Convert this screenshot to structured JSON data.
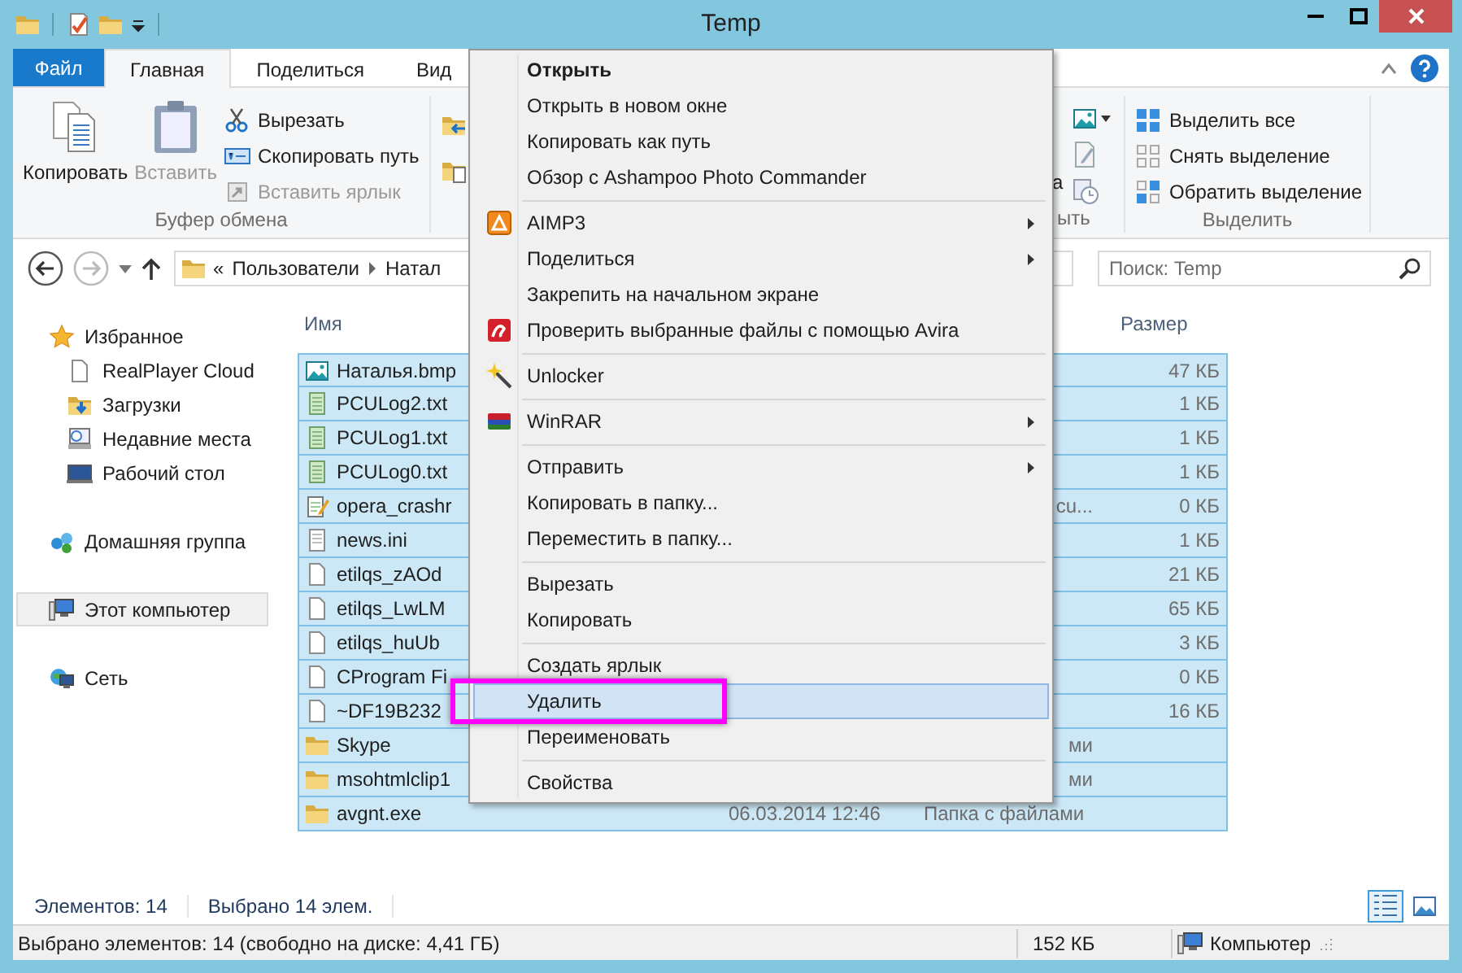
{
  "window": {
    "title": "Temp"
  },
  "ribbon": {
    "file_tab": "Файл",
    "tabs": [
      {
        "label": "Главная",
        "selected": true
      },
      {
        "label": "Поделиться",
        "selected": false
      },
      {
        "label": "Вид",
        "selected": false
      }
    ],
    "groups": [
      {
        "kind": "clipboard",
        "label": "Буфер обмена",
        "large": [
          {
            "label": "Копировать",
            "disabled": false
          },
          {
            "label": "Вставить",
            "disabled": true
          }
        ],
        "small": [
          {
            "label": "Вырезать",
            "disabled": false
          },
          {
            "label": "Скопировать путь",
            "disabled": false
          },
          {
            "label": "Вставить ярлык",
            "disabled": true
          }
        ]
      },
      {
        "kind": "organize"
      },
      {
        "kind": "open",
        "label": "ыть",
        "fragment": "а"
      },
      {
        "kind": "select",
        "label": "Выделить",
        "items": [
          "Выделить все",
          "Снять выделение",
          "Обратить выделение"
        ]
      }
    ]
  },
  "address": {
    "overflow": "«",
    "path": [
      "Пользователи",
      "Натал"
    ],
    "search_placeholder": "Поиск: Temp"
  },
  "nav": [
    {
      "label": "Избранное",
      "selected": false,
      "children": [
        {
          "label": "RealPlayer Cloud",
          "selected": false
        },
        {
          "label": "Загрузки",
          "selected": false
        },
        {
          "label": "Недавние места",
          "selected": false
        },
        {
          "label": "Рабочий стол",
          "selected": false
        }
      ]
    },
    {
      "label": "Домашняя группа",
      "selected": false
    },
    {
      "label": "Этот компьютер",
      "selected": true
    },
    {
      "label": "Сеть",
      "selected": false
    }
  ],
  "files": {
    "columns": [
      "Имя",
      "Размер"
    ],
    "rows": [
      {
        "kind": "image",
        "name": "Наталья.bmp",
        "size": "47 КБ",
        "selected": true
      },
      {
        "kind": "text",
        "name": "PCULog2.txt",
        "size": "1 КБ",
        "selected": true
      },
      {
        "kind": "text",
        "name": "PCULog1.txt",
        "size": "1 КБ",
        "selected": true
      },
      {
        "kind": "text",
        "name": "PCULog0.txt",
        "size": "1 КБ",
        "selected": true
      },
      {
        "kind": "script",
        "name": "opera_crashr",
        "type_tail": "cu...",
        "size": "0 КБ",
        "selected": true
      },
      {
        "kind": "ini",
        "name": "news.ini",
        "size": "1 КБ",
        "selected": true
      },
      {
        "kind": "file",
        "name": "etilqs_zAOd",
        "size": "21 КБ",
        "selected": true
      },
      {
        "kind": "file",
        "name": "etilqs_LwLM",
        "size": "65 КБ",
        "selected": true
      },
      {
        "kind": "file",
        "name": "etilqs_huUb",
        "size": "3 КБ",
        "selected": true
      },
      {
        "kind": "file",
        "name": "CProgram Fi",
        "size": "0 КБ",
        "selected": true
      },
      {
        "kind": "file",
        "name": "~DF19B232",
        "size": "16 КБ",
        "selected": true
      },
      {
        "kind": "folder",
        "name": "Skype",
        "type_tail": "ми",
        "selected": true
      },
      {
        "kind": "folder",
        "name": "msohtmlclip1",
        "type_tail": "ми",
        "selected": true
      },
      {
        "kind": "folder",
        "name": "avgnt.exe",
        "date": "06.03.2014 12:46",
        "type": "Папка с файлами",
        "selected": true
      }
    ]
  },
  "info": {
    "item_count": "Элементов: 14",
    "selection_count": "Выбрано 14 элем.",
    "views": [
      {
        "selected": true
      },
      {
        "selected": false
      }
    ]
  },
  "status_bar": {
    "summary": "Выбрано элементов: 14 (свободно на диске: 4,41 ГБ)",
    "size": "152 КБ",
    "location": "Компьютер"
  },
  "context_menu": {
    "items": [
      {
        "kind": "item",
        "label": "Открыть",
        "default": true,
        "submenu": false,
        "selected": false
      },
      {
        "kind": "item",
        "label": "Открыть в новом окне",
        "default": false,
        "submenu": false,
        "selected": false
      },
      {
        "kind": "item",
        "label": "Копировать как путь",
        "default": false,
        "submenu": false,
        "selected": false
      },
      {
        "kind": "item",
        "label": "Обзор с Ashampoo Photo Commander",
        "default": false,
        "submenu": false,
        "selected": false
      },
      {
        "kind": "separator"
      },
      {
        "kind": "item",
        "label": "AIMP3",
        "default": false,
        "submenu": true,
        "selected": false
      },
      {
        "kind": "item",
        "label": "Поделиться",
        "default": false,
        "submenu": true,
        "selected": false
      },
      {
        "kind": "item",
        "label": "Закрепить на начальном экране",
        "default": false,
        "submenu": false,
        "selected": false
      },
      {
        "kind": "item",
        "label": "Проверить выбранные файлы с помощью Avira",
        "default": false,
        "submenu": false,
        "selected": false
      },
      {
        "kind": "separator"
      },
      {
        "kind": "item",
        "label": "Unlocker",
        "default": false,
        "submenu": false,
        "selected": false
      },
      {
        "kind": "separator"
      },
      {
        "kind": "item",
        "label": "WinRAR",
        "default": false,
        "submenu": true,
        "selected": false
      },
      {
        "kind": "separator"
      },
      {
        "kind": "item",
        "label": "Отправить",
        "default": false,
        "submenu": true,
        "selected": false
      },
      {
        "kind": "item",
        "label": "Копировать в папку...",
        "default": false,
        "submenu": false,
        "selected": false
      },
      {
        "kind": "item",
        "label": "Переместить в папку...",
        "default": false,
        "submenu": false,
        "selected": false
      },
      {
        "kind": "separator"
      },
      {
        "kind": "item",
        "label": "Вырезать",
        "default": false,
        "submenu": false,
        "selected": false
      },
      {
        "kind": "item",
        "label": "Копировать",
        "default": false,
        "submenu": false,
        "selected": false
      },
      {
        "kind": "separator"
      },
      {
        "kind": "item",
        "label": "Создать ярлык",
        "default": false,
        "submenu": false,
        "selected": false
      },
      {
        "kind": "item",
        "label": "Удалить",
        "default": false,
        "submenu": false,
        "selected": true
      },
      {
        "kind": "item",
        "label": "Переименовать",
        "default": false,
        "submenu": false,
        "selected": false
      },
      {
        "kind": "separator"
      },
      {
        "kind": "item",
        "label": "Свойства",
        "default": false,
        "submenu": false,
        "selected": false
      }
    ]
  }
}
